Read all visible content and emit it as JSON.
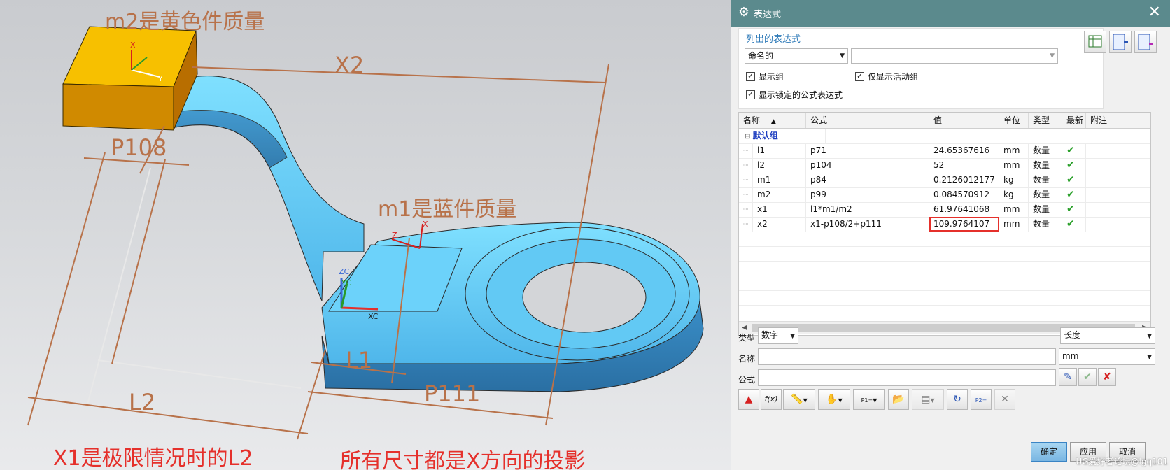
{
  "viewport": {
    "annotations": {
      "m2_note": "m2是黄色件质量",
      "m1_note": "m1是蓝件质量",
      "x1_note": "X1是极限情况时的L2",
      "proj_note": "所有尺寸都是X方向的投影"
    },
    "dims": {
      "x2": "X2",
      "p108": "P108",
      "l1": "L1",
      "l2": "L2",
      "p111": "P111"
    },
    "axes": {
      "x": "X",
      "y": "Y",
      "z": "Z",
      "zc": "ZC",
      "yc": "YC",
      "xc": "XC"
    },
    "colors": {
      "yellow_part": "#f5b800",
      "blue_part": "#5ec8f2",
      "dimension": "#b8724a",
      "highlight": "#e5302b"
    }
  },
  "dialog": {
    "title": "表达式",
    "list_heading": "列出的表达式",
    "filter_select": "命名的",
    "filter_value": "",
    "checkboxes": {
      "show_groups": "显示组",
      "active_only": "仅显示活动组",
      "show_locked": "显示锁定的公式表达式"
    },
    "columns": {
      "name": "名称",
      "formula": "公式",
      "value": "值",
      "unit": "单位",
      "type": "类型",
      "latest": "最新",
      "comment": "附注"
    },
    "group_name": "默认组",
    "rows": [
      {
        "name": "l1",
        "formula": "p71",
        "value": "24.65367616",
        "unit": "mm",
        "type": "数量"
      },
      {
        "name": "l2",
        "formula": "p104",
        "value": "52",
        "unit": "mm",
        "type": "数量"
      },
      {
        "name": "m1",
        "formula": "p84",
        "value": "0.2126012177",
        "unit": "kg",
        "type": "数量"
      },
      {
        "name": "m2",
        "formula": "p99",
        "value": "0.084570912",
        "unit": "kg",
        "type": "数量"
      },
      {
        "name": "x1",
        "formula": "l1*m1/m2",
        "value": "61.97641068",
        "unit": "mm",
        "type": "数量"
      },
      {
        "name": "x2",
        "formula": "x1-p108/2+p111",
        "value": "109.9764107",
        "unit": "mm",
        "type": "数量"
      }
    ],
    "editor": {
      "type_label": "类型",
      "type_value": "数字",
      "dimension_value": "长度",
      "name_label": "名称",
      "name_value": "",
      "unit_value": "mm",
      "formula_label": "公式",
      "formula_value": "",
      "fx_label": "f(x)",
      "p1_label": "P1=",
      "p2_label": "P2="
    },
    "buttons": {
      "ok": "确定",
      "apply": "应用",
      "cancel": "取消"
    },
    "watermark": "UG爱好者论坛@lgq101"
  }
}
